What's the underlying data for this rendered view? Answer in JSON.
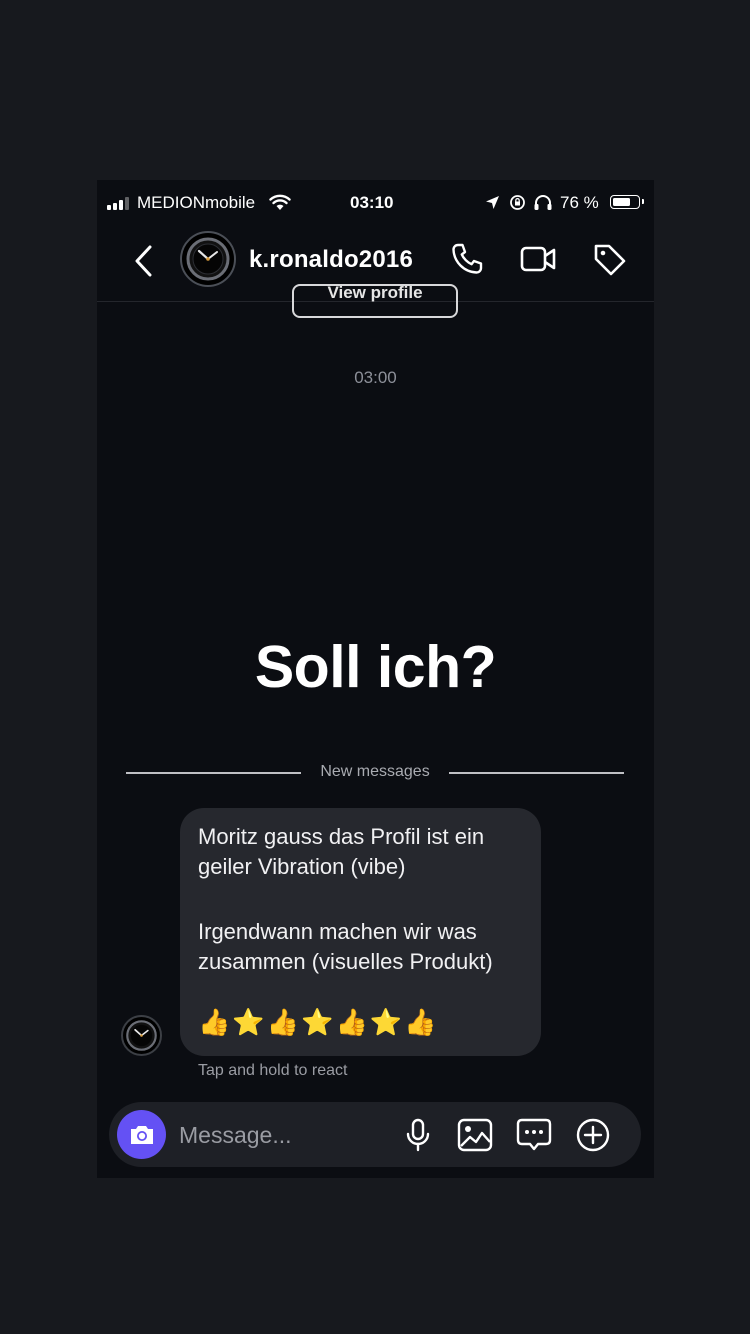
{
  "status_bar": {
    "carrier": "MEDIONmobile",
    "time": "03:10",
    "battery_text": "76 %",
    "battery_level": 0.76
  },
  "header": {
    "username": "k.ronaldo2016"
  },
  "chat": {
    "view_profile_label": "View profile",
    "timestamp": "03:00",
    "story_text": "Soll ich?",
    "new_messages_label": "New messages",
    "message": {
      "line1": "Moritz gauss das Profil ist ein geiler Vibration (vibe)",
      "line2": "Irgendwann machen wir was zusammen (visuelles Produkt)",
      "emojis": "👍⭐👍⭐👍⭐👍"
    },
    "react_hint": "Tap and hold to react"
  },
  "composer": {
    "placeholder": "Message..."
  },
  "colors": {
    "background": "#0b0d12",
    "bubble": "#26282e",
    "camera_button": "#6451f4"
  }
}
